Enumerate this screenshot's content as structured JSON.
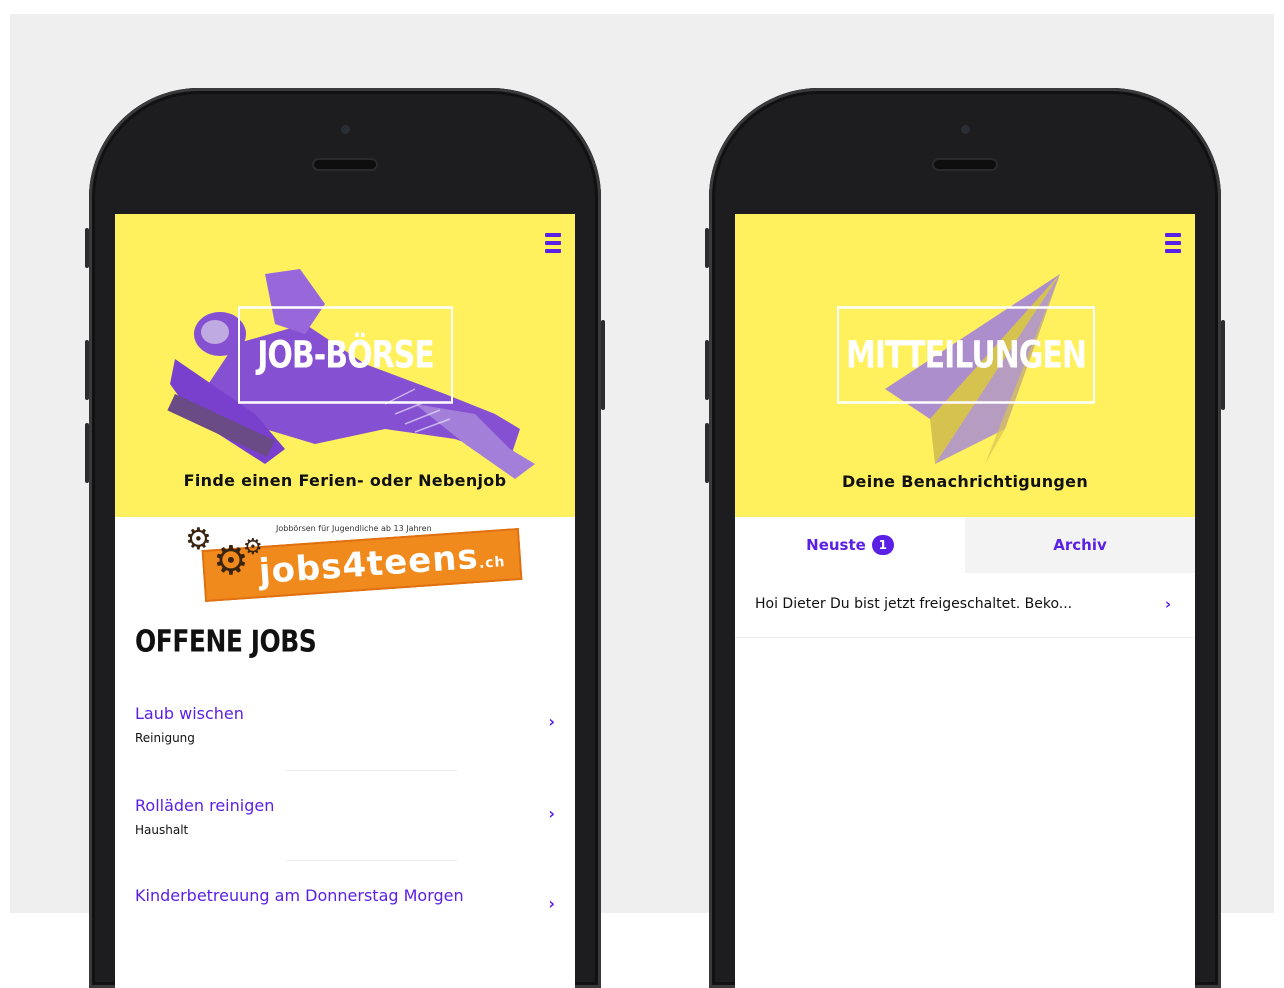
{
  "left_phone": {
    "hero": {
      "title": "JOB-BÖRSE",
      "subtitle": "Finde einen Ferien- oder Nebenjob",
      "menu_icon": "hamburger-menu-icon"
    },
    "banner": {
      "tagline": "Jobbörsen für Jugendliche ab 13 Jahren",
      "brand_main": "jobs4teens",
      "brand_suffix": ".ch"
    },
    "section_title": "OFFENE JOBS",
    "jobs": [
      {
        "title": "Laub wischen",
        "category": "Reinigung"
      },
      {
        "title": "Rolläden reinigen",
        "category": "Haushalt"
      },
      {
        "title": "Kinderbetreuung am Donnerstag Morgen",
        "category": ""
      }
    ],
    "chevron": "›"
  },
  "right_phone": {
    "hero": {
      "title": "MITTEILUNGEN",
      "subtitle": "Deine Benachrichtigungen",
      "menu_icon": "hamburger-menu-icon"
    },
    "tabs": [
      {
        "label": "Neuste",
        "badge": "1"
      },
      {
        "label": "Archiv"
      }
    ],
    "messages": [
      {
        "text": "Hoi Dieter Du bist jetzt freigeschaltet. Beko..."
      }
    ],
    "chevron": "›"
  },
  "colors": {
    "accent": "#5b20e6",
    "hero_yellow": "#fff15e",
    "banner_orange": "#f08a1c"
  }
}
